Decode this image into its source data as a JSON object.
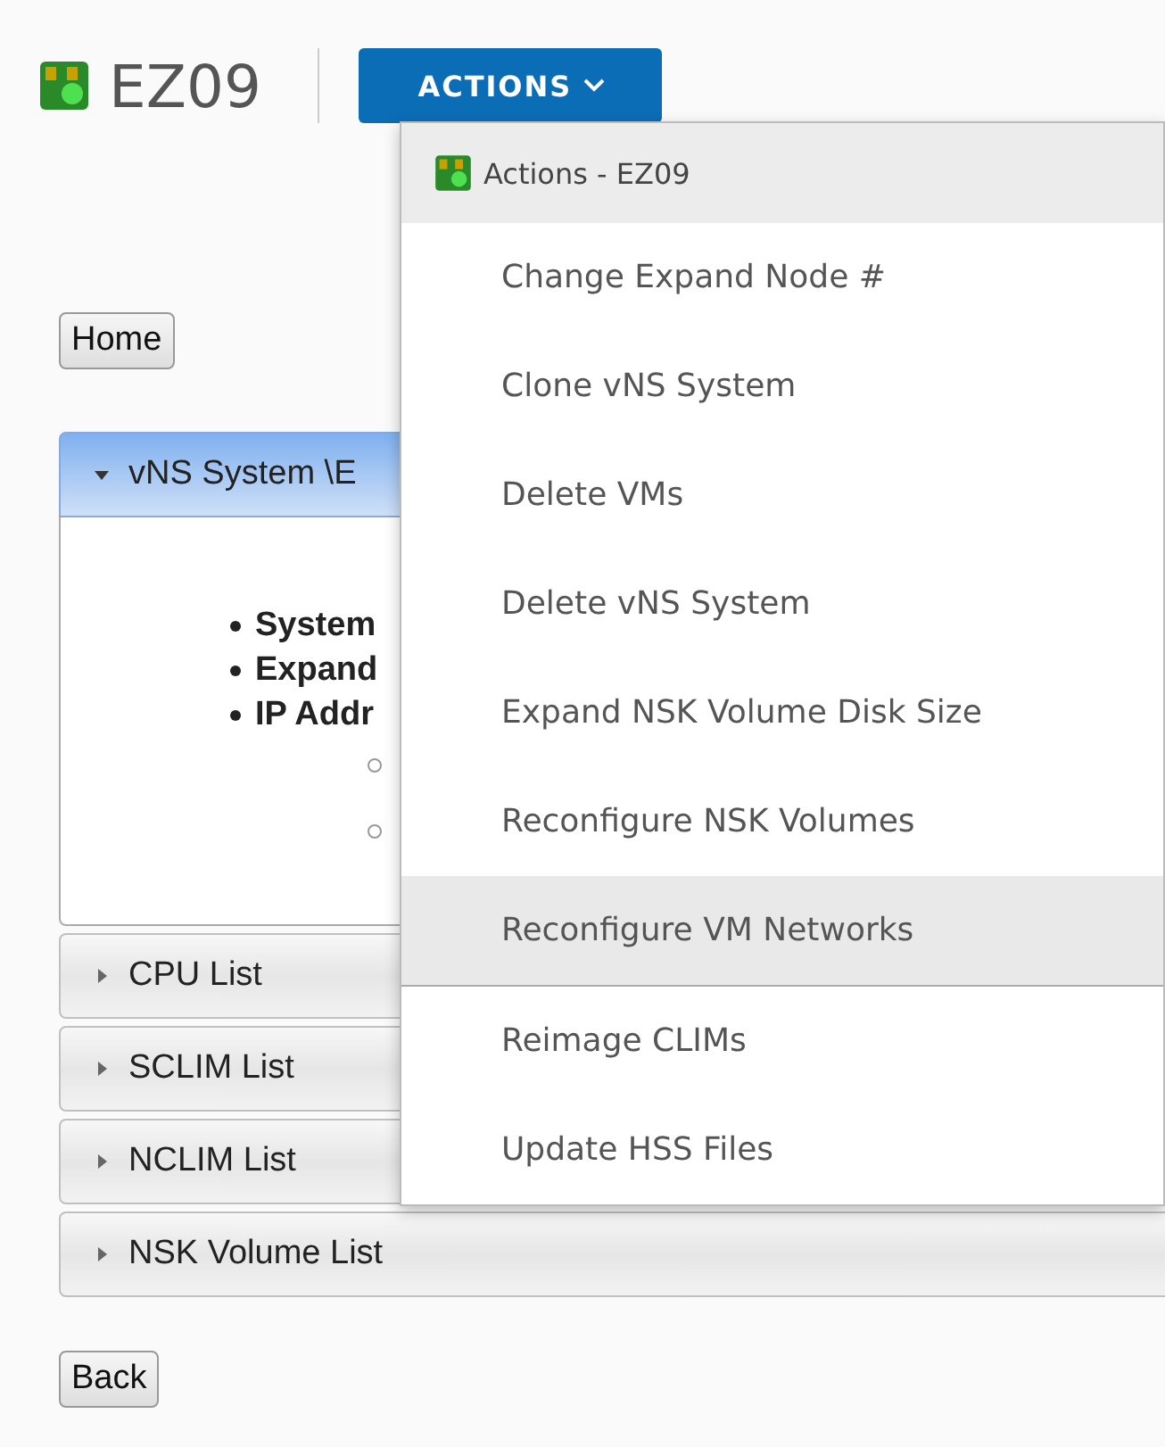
{
  "header": {
    "title": "EZ09",
    "actions_button": "ACTIONS"
  },
  "home_button": "Home",
  "accordion": [
    {
      "title": "vNS System \\E",
      "expanded": true,
      "bullets": [
        "System",
        "Expand",
        "IP Addr"
      ],
      "sub_items": [
        {
          "kind": "hollow-bullet"
        },
        {
          "kind": "hollow-bullet"
        }
      ]
    },
    {
      "title": "CPU List",
      "expanded": false
    },
    {
      "title": "SCLIM List",
      "expanded": false
    },
    {
      "title": "NCLIM List",
      "expanded": false
    },
    {
      "title": "NSK Volume List",
      "expanded": false
    }
  ],
  "back_button": "Back",
  "menu": {
    "title": "Actions - EZ09",
    "items": [
      {
        "label": "Change Expand Node #",
        "selected": false,
        "divider_after": false
      },
      {
        "label": "Clone vNS System",
        "selected": false,
        "divider_after": false
      },
      {
        "label": "Delete VMs",
        "selected": false,
        "divider_after": false
      },
      {
        "label": "Delete vNS System",
        "selected": false,
        "divider_after": false
      },
      {
        "label": "Expand NSK Volume Disk Size",
        "selected": false,
        "divider_after": false
      },
      {
        "label": "Reconfigure NSK Volumes",
        "selected": false,
        "divider_after": false
      },
      {
        "label": "Reconfigure VM Networks",
        "selected": true,
        "divider_after": true
      },
      {
        "label": "Reimage CLIMs",
        "selected": false,
        "divider_after": false
      },
      {
        "label": "Update HSS Files",
        "selected": false,
        "divider_after": false
      }
    ]
  }
}
